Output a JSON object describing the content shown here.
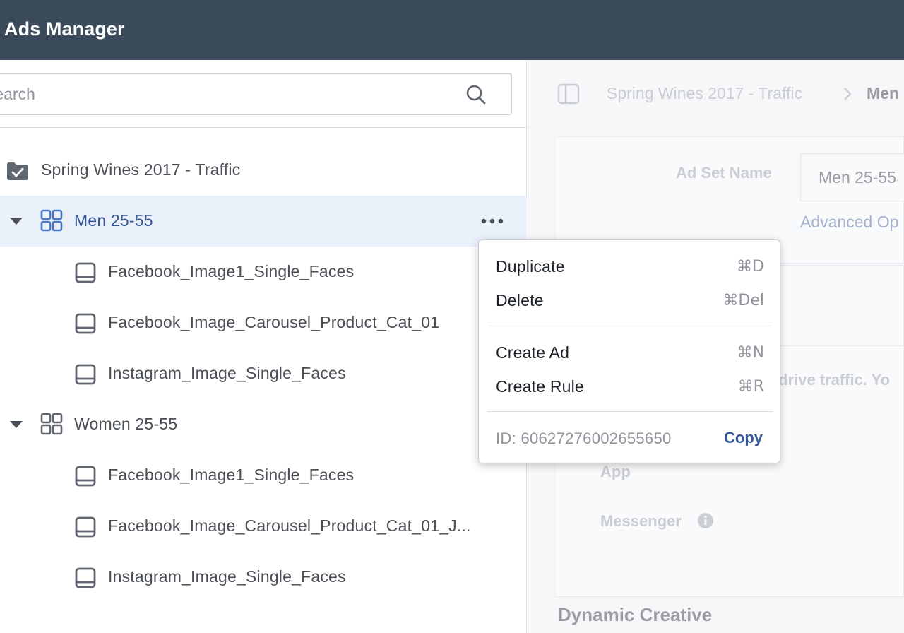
{
  "app": {
    "title": "Ads Manager"
  },
  "search": {
    "placeholder": "Search"
  },
  "tree": {
    "campaign": {
      "label": "Spring Wines 2017 - Traffic"
    },
    "ad_sets": [
      {
        "label": "Men 25-55",
        "ads": [
          "Facebook_Image1_Single_Faces",
          "Facebook_Image_Carousel_Product_Cat_01",
          "Instagram_Image_Single_Faces"
        ]
      },
      {
        "label": "Women 25-55",
        "ads": [
          "Facebook_Image1_Single_Faces",
          "Facebook_Image_Carousel_Product_Cat_01_J...",
          "Instagram_Image_Single_Faces"
        ]
      }
    ]
  },
  "context_menu": {
    "items": [
      {
        "label": "Duplicate",
        "shortcut": "⌘D"
      },
      {
        "label": "Delete",
        "shortcut": "⌘Del"
      },
      {
        "label": "Create Ad",
        "shortcut": "⌘N"
      },
      {
        "label": "Create Rule",
        "shortcut": "⌘R"
      }
    ],
    "id_text": "ID: 6062727600265565​0",
    "copy_label": "Copy"
  },
  "right_panel": {
    "breadcrumb": [
      "Spring Wines 2017 - Traffic",
      "Men"
    ],
    "ad_set_name_label": "Ad Set Name",
    "ad_set_name_value": "Men 25-55",
    "advanced_options": "Advanced Op",
    "traffic_text": "drive traffic. Yo",
    "app_label": "App",
    "messenger_label": "Messenger",
    "dynamic_creative": "Dynamic Creative"
  },
  "colors": {
    "topbar": "#3b4a5b",
    "selected_row": "#ebf1fb",
    "link_blue": "#365899",
    "icon_blue": "#4a76c7"
  }
}
